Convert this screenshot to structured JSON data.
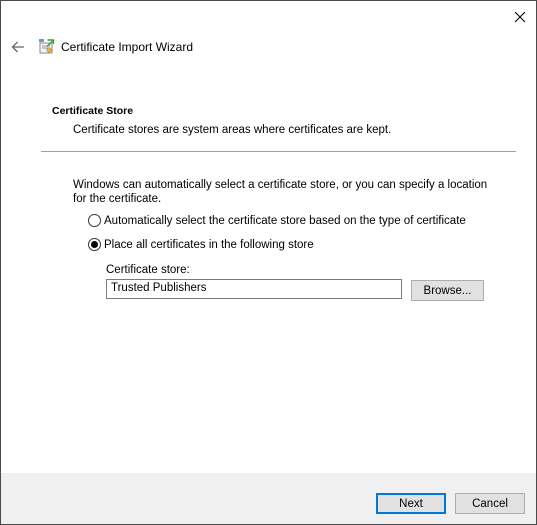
{
  "window": {
    "title": "Certificate Import Wizard"
  },
  "icons": {
    "close": "close-icon",
    "back": "back-arrow-icon",
    "wizard": "certificate-wizard-icon"
  },
  "section": {
    "heading": "Certificate Store",
    "description": "Certificate stores are system areas where certificates are kept."
  },
  "body": {
    "intro": "Windows can automatically select a certificate store, or you can specify a location for the certificate.",
    "options": [
      {
        "label": "Automatically select the certificate store based on the type of certificate",
        "selected": false
      },
      {
        "label": "Place all certificates in the following store",
        "selected": true
      }
    ],
    "store_label": "Certificate store:",
    "store_value": "Trusted Publishers",
    "browse_label": "Browse..."
  },
  "footer": {
    "next_label": "Next",
    "cancel_label": "Cancel"
  },
  "colors": {
    "accent": "#0078d7",
    "button_bg": "#e1e1e1",
    "footer_bg": "#f0f0f0"
  }
}
